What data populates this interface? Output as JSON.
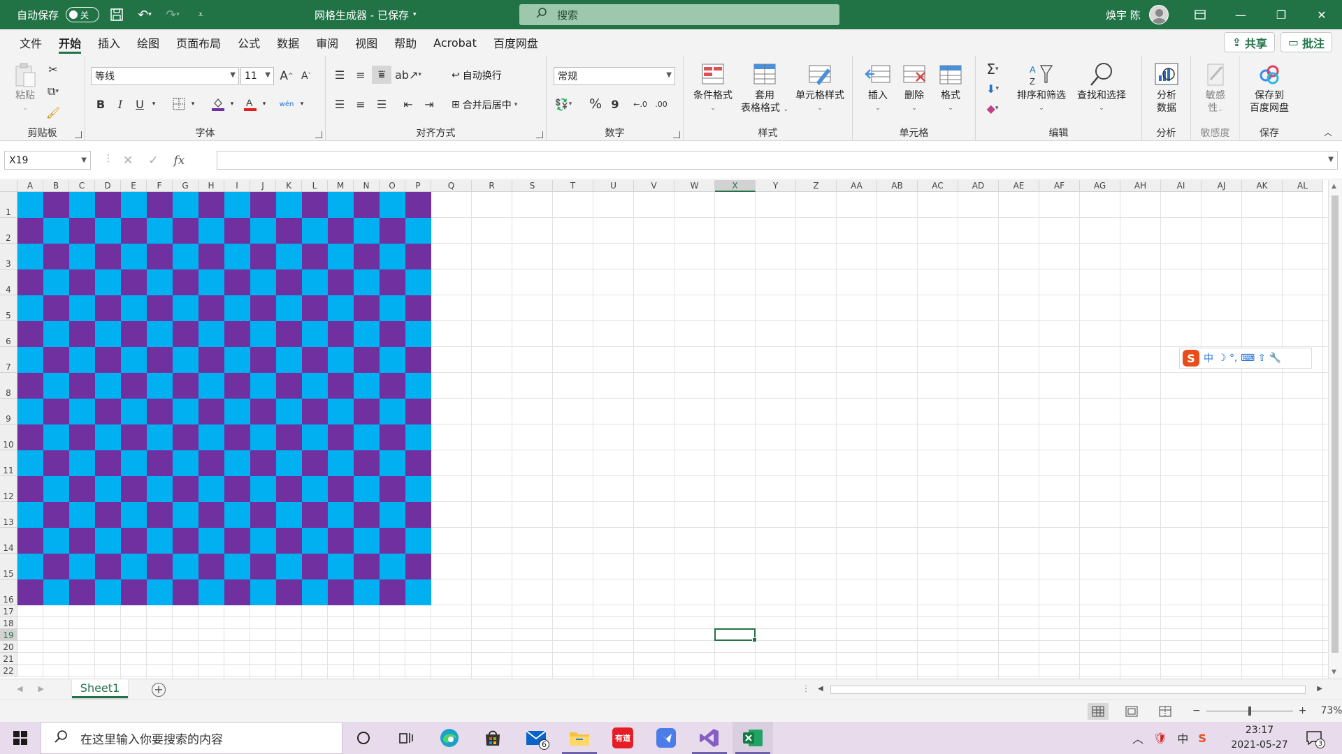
{
  "titlebar": {
    "autosave_label": "自动保存",
    "autosave_state": "关",
    "doc_title": "网格生成器 - 已保存",
    "search_placeholder": "搜索",
    "user_name": "焕宇 陈",
    "accent_color": "#217346"
  },
  "menu": {
    "tabs": [
      "文件",
      "开始",
      "插入",
      "绘图",
      "页面布局",
      "公式",
      "数据",
      "审阅",
      "视图",
      "帮助",
      "Acrobat",
      "百度网盘"
    ],
    "active_tab": "开始",
    "share_label": "共享",
    "comment_label": "批注"
  },
  "ribbon": {
    "clipboard": {
      "paste_label": "粘贴",
      "group_label": "剪贴板"
    },
    "font": {
      "font_name": "等线",
      "font_size": "11",
      "group_label": "字体",
      "grow": "A",
      "shrink": "A",
      "bold": "B",
      "italic": "I",
      "underline": "U",
      "phonetic": "wén"
    },
    "alignment": {
      "wrap_label": "自动换行",
      "merge_label": "合并后居中",
      "group_label": "对齐方式"
    },
    "number": {
      "format": "常规",
      "group_label": "数字",
      "percent": "%",
      "comma": "9"
    },
    "styles": {
      "conditional": "条件格式",
      "table_format_1": "套用",
      "table_format_2": "表格格式",
      "cell_styles": "单元格样式",
      "group_label": "样式"
    },
    "cells": {
      "insert": "插入",
      "delete": "删除",
      "format": "格式",
      "group_label": "单元格"
    },
    "editing": {
      "sort_filter": "排序和筛选",
      "find_select": "查找和选择",
      "group_label": "编辑"
    },
    "analysis": {
      "analyze_1": "分析",
      "analyze_2": "数据",
      "group_label": "分析"
    },
    "sensitivity": {
      "label_1": "敏感",
      "label_2": "性",
      "group_label": "敏感度"
    },
    "save": {
      "label_1": "保存到",
      "label_2": "百度网盘",
      "group_label": "保存"
    }
  },
  "formula_bar": {
    "name_box": "X19",
    "fx": "fx",
    "formula": ""
  },
  "grid": {
    "columns": [
      "A",
      "B",
      "C",
      "D",
      "E",
      "F",
      "G",
      "H",
      "I",
      "J",
      "K",
      "L",
      "M",
      "N",
      "O",
      "P",
      "Q",
      "R",
      "S",
      "T",
      "U",
      "V",
      "W",
      "X",
      "Y",
      "Z",
      "AA",
      "AB",
      "AC",
      "AD",
      "AE",
      "AF",
      "AG",
      "AH",
      "AI",
      "AJ",
      "AK",
      "AL"
    ],
    "rows": [
      "1",
      "2",
      "3",
      "4",
      "5",
      "6",
      "7",
      "8",
      "9",
      "10",
      "11",
      "12",
      "13",
      "14",
      "15",
      "16",
      "17",
      "18",
      "19",
      "20",
      "21",
      "22"
    ],
    "selected_cell": "X19",
    "checker_colors": {
      "primary": "#00b0f0",
      "secondary": "#7030a0"
    },
    "checker_size": {
      "cols": 16,
      "rows": 16
    }
  },
  "ime": {
    "logo": "S",
    "mode": "中",
    "items": "☽ °, ⌨ ⇧ 🔧"
  },
  "sheets": {
    "tabs": [
      "Sheet1"
    ],
    "active": "Sheet1"
  },
  "statusbar": {
    "zoom": "73%"
  },
  "taskbar": {
    "search_placeholder": "在这里输入你要搜索的内容",
    "mail_badge": "6",
    "youdao_label": "有道",
    "ime_tray": "中",
    "time": "23:17",
    "date": "2021-05-27",
    "notification_count": "3"
  }
}
